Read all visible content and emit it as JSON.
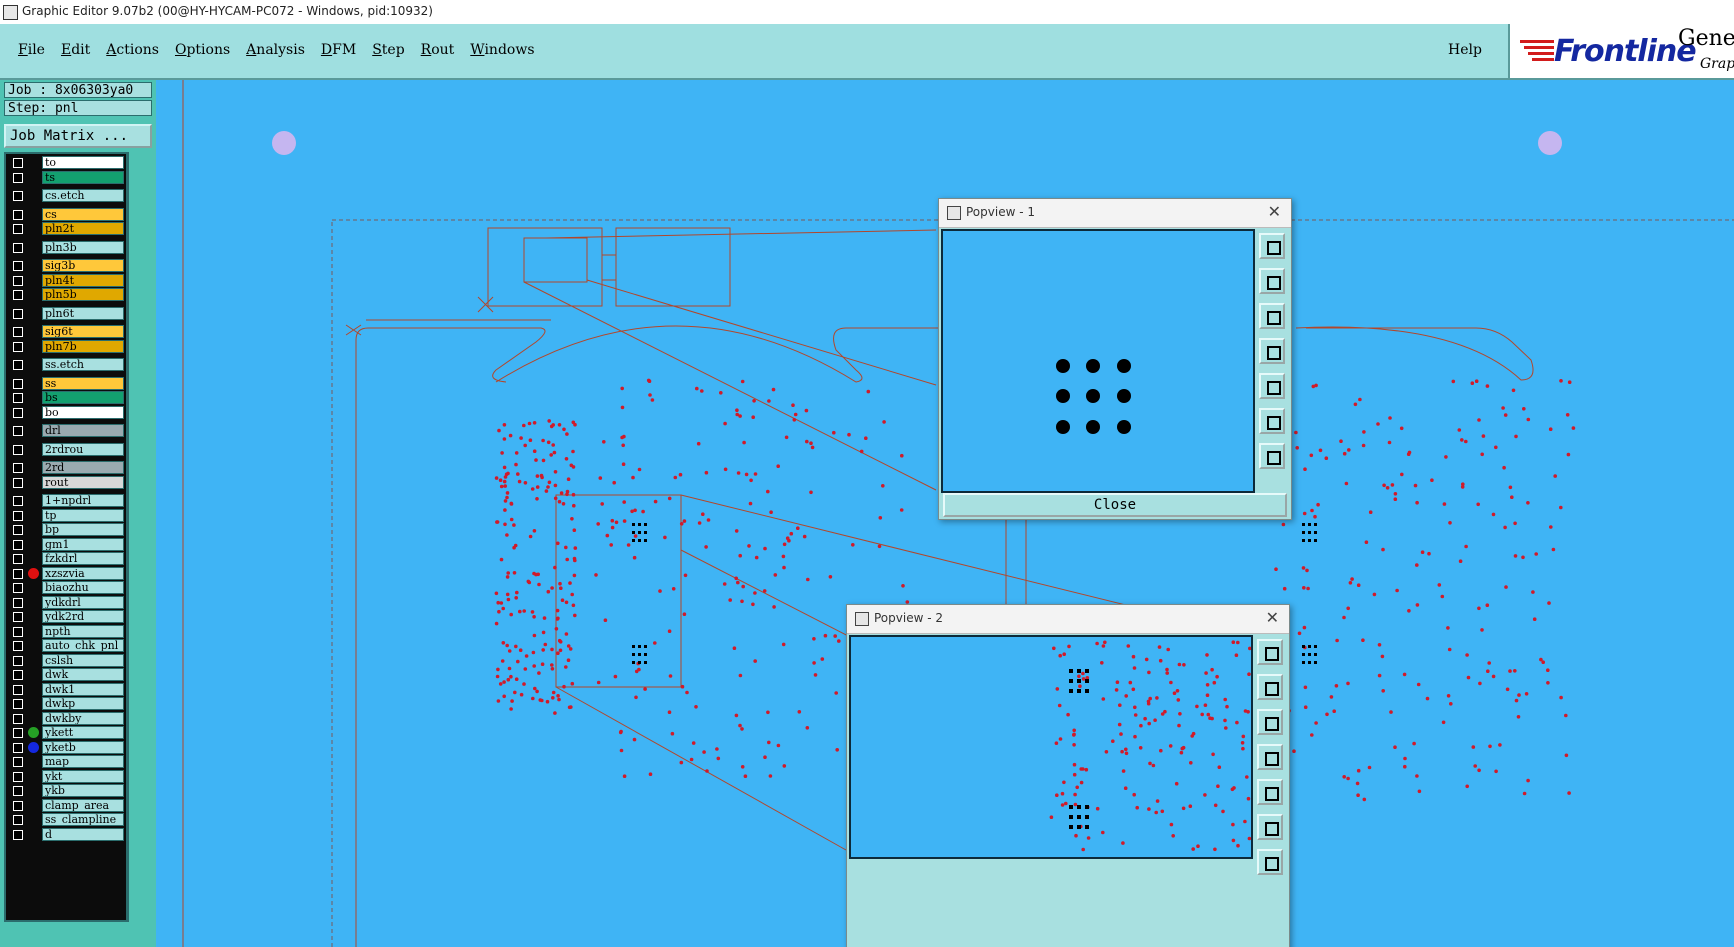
{
  "window": {
    "title": "Graphic Editor 9.07b2 (00@HY-HYCAM-PC072 - Windows, pid:10932)"
  },
  "menu": [
    "File",
    "Edit",
    "Actions",
    "Options",
    "Analysis",
    "DFM",
    "Step",
    "Rout",
    "Windows"
  ],
  "help_label": "Help",
  "logo": {
    "brand": "Frontline",
    "product": "Genes",
    "sub": "Graph"
  },
  "job": {
    "job_label": "Job : 8x06303ya0",
    "step_label": "Step: pnl",
    "matrix_button": "Job Matrix ..."
  },
  "layers": [
    {
      "name": "to",
      "color": "#ffffff"
    },
    {
      "name": "ts",
      "color": "#13a06f"
    },
    {
      "name": "cs.etch",
      "color": "#a8e0e0"
    },
    {
      "name": "cs",
      "color": "#ffc83a"
    },
    {
      "name": "pln2t",
      "color": "#e0a800"
    },
    {
      "name": "pln3b",
      "color": "#a8e0e0"
    },
    {
      "name": "sig3b",
      "color": "#ffc83a"
    },
    {
      "name": "pln4t",
      "color": "#e0a800"
    },
    {
      "name": "pln5b",
      "color": "#e0a800"
    },
    {
      "name": "pln6t",
      "color": "#a8e0e0"
    },
    {
      "name": "sig6t",
      "color": "#ffc83a"
    },
    {
      "name": "pln7b",
      "color": "#e0a800"
    },
    {
      "name": "ss.etch",
      "color": "#a8e0e0"
    },
    {
      "name": "ss",
      "color": "#ffc83a"
    },
    {
      "name": "bs",
      "color": "#13a06f"
    },
    {
      "name": "bo",
      "color": "#ffffff"
    },
    {
      "name": "drl",
      "color": "#9aaab0"
    },
    {
      "name": "2rdrou",
      "color": "#a8e0e0"
    },
    {
      "name": "2rd",
      "color": "#9aaab0"
    },
    {
      "name": "rout",
      "color": "#d8d8d8"
    },
    {
      "name": "1+npdrl",
      "color": "#a8e0e0"
    },
    {
      "name": "tp",
      "color": "#a8e0e0"
    },
    {
      "name": "bp",
      "color": "#a8e0e0"
    },
    {
      "name": "gm1",
      "color": "#a8e0e0"
    },
    {
      "name": "fzkdrl",
      "color": "#a8e0e0"
    },
    {
      "name": "xzszvia",
      "color": "#a8e0e0",
      "dot": "#e01010"
    },
    {
      "name": "biaozhu",
      "color": "#a8e0e0"
    },
    {
      "name": "ydkdrl",
      "color": "#a8e0e0"
    },
    {
      "name": "ydk2rd",
      "color": "#a8e0e0"
    },
    {
      "name": "npth",
      "color": "#a8e0e0"
    },
    {
      "name": "auto_chk_pnl",
      "color": "#a8e0e0"
    },
    {
      "name": "cslsh",
      "color": "#a8e0e0"
    },
    {
      "name": "dwk",
      "color": "#a8e0e0"
    },
    {
      "name": "dwk1",
      "color": "#a8e0e0"
    },
    {
      "name": "dwkp",
      "color": "#a8e0e0"
    },
    {
      "name": "dwkby",
      "color": "#a8e0e0"
    },
    {
      "name": "ykett",
      "color": "#a8e0e0",
      "dot": "#25a025"
    },
    {
      "name": "yketb",
      "color": "#a8e0e0",
      "dot": "#1428e0"
    },
    {
      "name": "map",
      "color": "#a8e0e0"
    },
    {
      "name": "ykt",
      "color": "#a8e0e0"
    },
    {
      "name": "ykb",
      "color": "#a8e0e0"
    },
    {
      "name": "clamp_area",
      "color": "#a8e0e0"
    },
    {
      "name": "ss_clampline",
      "color": "#a8e0e0"
    },
    {
      "name": "d",
      "color": "#a8e0e0"
    }
  ],
  "popview1": {
    "title": "Popview - 1",
    "close_label": "Close"
  },
  "popview2": {
    "title": "Popview - 2"
  },
  "colors": {
    "canvas": "#3fb4f5",
    "outline": "#b2472b",
    "pad": "#d01b2a",
    "panel": "#a8e0e0"
  }
}
